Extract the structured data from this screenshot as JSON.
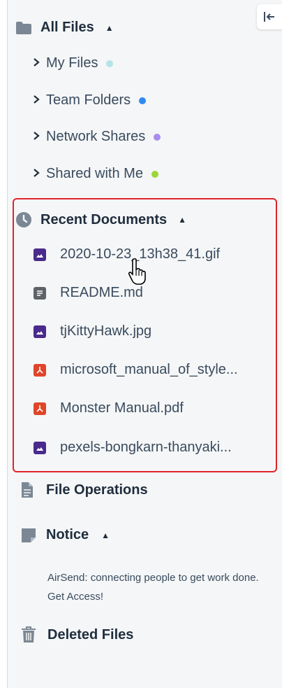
{
  "sidebar": {
    "all_files": {
      "label": "All Files",
      "expanded": true
    },
    "folders": [
      {
        "label": "My Files",
        "dot_color": "#b6e3e6"
      },
      {
        "label": "Team Folders",
        "dot_color": "#2f8af0"
      },
      {
        "label": "Network Shares",
        "dot_color": "#a98cf0"
      },
      {
        "label": "Shared with Me",
        "dot_color": "#9ed63a"
      }
    ],
    "recent": {
      "label": "Recent Documents",
      "expanded": true,
      "items": [
        {
          "name": "2020-10-23_13h38_41.gif",
          "icon": "image-icon",
          "color": "#4a2a8c"
        },
        {
          "name": "README.md",
          "icon": "text-file-icon",
          "color": "#5f6368"
        },
        {
          "name": "tjKittyHawk.jpg",
          "icon": "image-icon",
          "color": "#4a2a8c"
        },
        {
          "name": "microsoft_manual_of_style...",
          "icon": "pdf-icon",
          "color": "#e0452a"
        },
        {
          "name": "Monster Manual.pdf",
          "icon": "pdf-icon",
          "color": "#e0452a"
        },
        {
          "name": "pexels-bongkarn-thanyaki...",
          "icon": "image-icon",
          "color": "#4a2a8c"
        }
      ]
    },
    "file_operations": {
      "label": "File Operations"
    },
    "notice": {
      "label": "Notice",
      "expanded": true,
      "text": "AirSend: connecting people to get work done. Get Access!"
    },
    "deleted_files": {
      "label": "Deleted Files"
    }
  },
  "colors": {
    "panel_bg": "#f5f6f7",
    "highlight_border": "#e0242a",
    "text_primary": "#1f2d3d",
    "icon_gray": "#7b8794"
  }
}
